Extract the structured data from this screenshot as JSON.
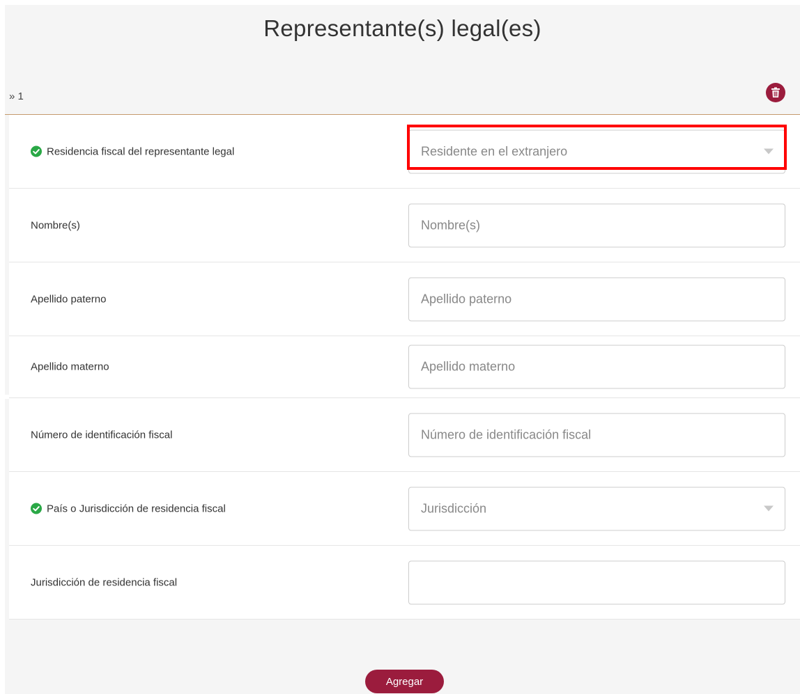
{
  "page": {
    "title": "Representante(s) legal(es)"
  },
  "section": {
    "index_label": "» 1",
    "delete_icon": "trash-icon"
  },
  "form": {
    "fields": [
      {
        "label": "Residencia fiscal del representante legal",
        "validated": true,
        "type": "select",
        "value": "Residente en el extranjero"
      },
      {
        "label": "Nombre(s)",
        "validated": false,
        "type": "text",
        "placeholder": "Nombre(s)"
      },
      {
        "label": "Apellido paterno",
        "validated": false,
        "type": "text",
        "placeholder": "Apellido paterno"
      },
      {
        "label": "Apellido materno",
        "validated": false,
        "type": "text",
        "placeholder": "Apellido materno"
      },
      {
        "label": "Número de identificación fiscal",
        "validated": false,
        "type": "text",
        "placeholder": "Número de identificación fiscal"
      },
      {
        "label": "País o Jurisdicción de residencia fiscal",
        "validated": true,
        "type": "select",
        "value": "Jurisdicción"
      },
      {
        "label": "Jurisdicción de residencia fiscal",
        "validated": false,
        "type": "text",
        "placeholder": ""
      }
    ]
  },
  "actions": {
    "add_label": "Agregar"
  },
  "colors": {
    "accent": "#9b1c3d",
    "valid_check": "#2aa846",
    "section_rule": "#c49a6c",
    "highlight": "#ff0000"
  }
}
